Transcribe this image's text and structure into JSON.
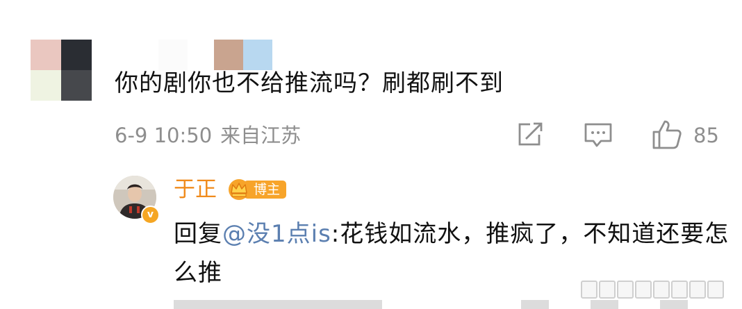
{
  "comment": {
    "text": "你的剧你也不给推流吗？刷都刷不到",
    "date": "6-9 10:50",
    "location": "来自江苏",
    "like_count": "85",
    "icons": {
      "share": "share-icon",
      "comment": "comment-icon",
      "like": "thumbs-up-icon"
    },
    "avatar_colors": [
      "#eac7c0",
      "#2a2d33",
      "#eff3e2",
      "#46484c"
    ],
    "name_blur_colors": [
      "#c9a48f",
      "#b8d8f0"
    ]
  },
  "reply": {
    "author": "于正",
    "badge_label": "博主",
    "prefix": "回复",
    "mention": "@没1点is",
    "body": ":花钱如流水，推疯了，不知道还要怎么推",
    "verified_icon": "verified-v-icon",
    "crown_icon": "crown-icon"
  },
  "colors": {
    "author": "#f08b1c",
    "mention": "#5b7fb0",
    "meta": "#8e8e8e",
    "badge": "#f7a42a"
  }
}
